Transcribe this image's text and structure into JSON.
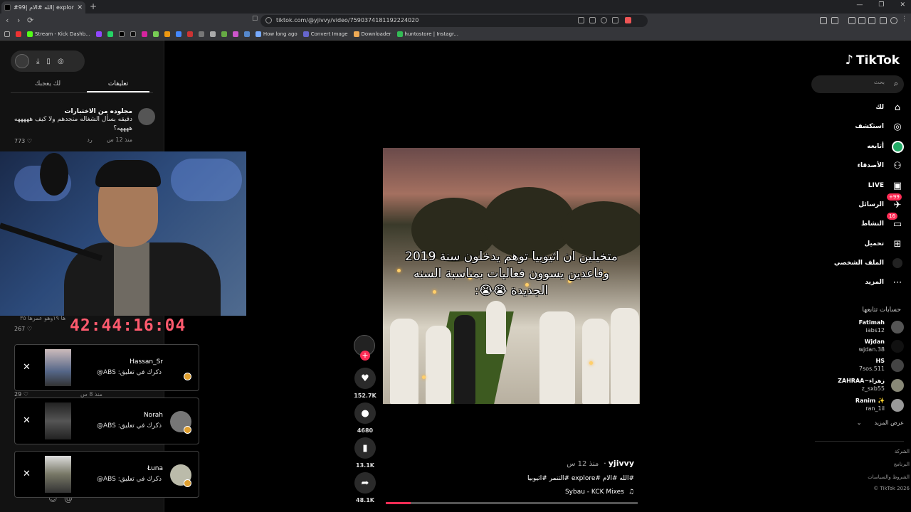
{
  "browser": {
    "tab_title": "#الله #الام |99| explore# #التنمر",
    "url": "tiktok.com/@yjivvy/video/7590374181192224020",
    "bookmarks": [
      "Stream - Kick Dashb...",
      "How long ago",
      "Convert Image",
      "Downloader",
      "huntostore | Instagr..."
    ]
  },
  "comments_panel": {
    "tabs": [
      "لك يعجبك",
      "تعليقات"
    ],
    "comment": {
      "author": "مجلوده من الاختبارات",
      "text": "دقيقه بسأل الشغاله منجدهم ولا كيف هههههه ههههه؟",
      "time": "منذ 12 س",
      "reply": "رد",
      "likes": "773"
    },
    "bg_snippet_1": "ها ١٩وهو عمرها ٣٥",
    "bg_likes_1": "267",
    "bg_meta_2": "منذ 8 س",
    "bg_likes_2": "29"
  },
  "timer": "42:44:16:04",
  "notifications": [
    {
      "name": "Hassan_Sr",
      "text": "ذكرك في تعليق: ABS@"
    },
    {
      "name": "Norah",
      "text": "ذكرك في تعليق: ABS@"
    },
    {
      "name": "Łuna",
      "text": "ذكرك في تعليق: ABS@"
    }
  ],
  "video": {
    "caption": "متخيلين ان اثيوبيا توهم يدخلون سنة 2019 وقاعدين يسوون فعاليات بمناسبة السنه الجديدة 😭😭:",
    "author": "yjivvy",
    "time": "منذ 12 س",
    "hashtags": "#الله #الام #explore #التنمر #اثيوبيا",
    "music": "Sybau - KCK Mixes",
    "progress_fraction": 0.1,
    "likes": "152.7K",
    "comments": "4680",
    "saves": "13.1K",
    "shares": "48.1K"
  },
  "sidebar": {
    "logo": "TikTok",
    "search_placeholder": "بحث",
    "nav": [
      {
        "label": "لك",
        "icon": "home-icon"
      },
      {
        "label": "استكشف",
        "icon": "compass-icon"
      },
      {
        "label": "أتابعه",
        "icon": "following-avatar-icon"
      },
      {
        "label": "الأصدقاء",
        "icon": "friends-icon"
      },
      {
        "label": "LIVE",
        "icon": "live-icon"
      },
      {
        "label": "الرسائل",
        "icon": "messages-icon",
        "badge": "+99"
      },
      {
        "label": "النشاط",
        "icon": "activity-icon",
        "badge": "16"
      },
      {
        "label": "تحميل",
        "icon": "upload-icon"
      },
      {
        "label": "الملف الشخصي",
        "icon": "profile-icon"
      },
      {
        "label": "المزيد",
        "icon": "more-icon"
      }
    ],
    "following_title": "حسابات تتابعها",
    "following": [
      {
        "name": "Fatimah",
        "handle": "iabs12"
      },
      {
        "name": "Wjdan",
        "handle": "wjdan.38"
      },
      {
        "name": "HS",
        "handle": "7sos.511"
      },
      {
        "name": "ZAHRAA~زهراء",
        "handle": "z_sxb55"
      },
      {
        "name": "Ranim ✨",
        "handle": "ran_1il"
      }
    ],
    "see_more": "عرض المزيد",
    "footer": [
      "الشركة",
      "البرنامج",
      "الشروط والسياسات",
      "TikTok 2026 ©"
    ]
  },
  "colors": {
    "accent": "#fe2c55",
    "timer": "#ff5a6e"
  }
}
